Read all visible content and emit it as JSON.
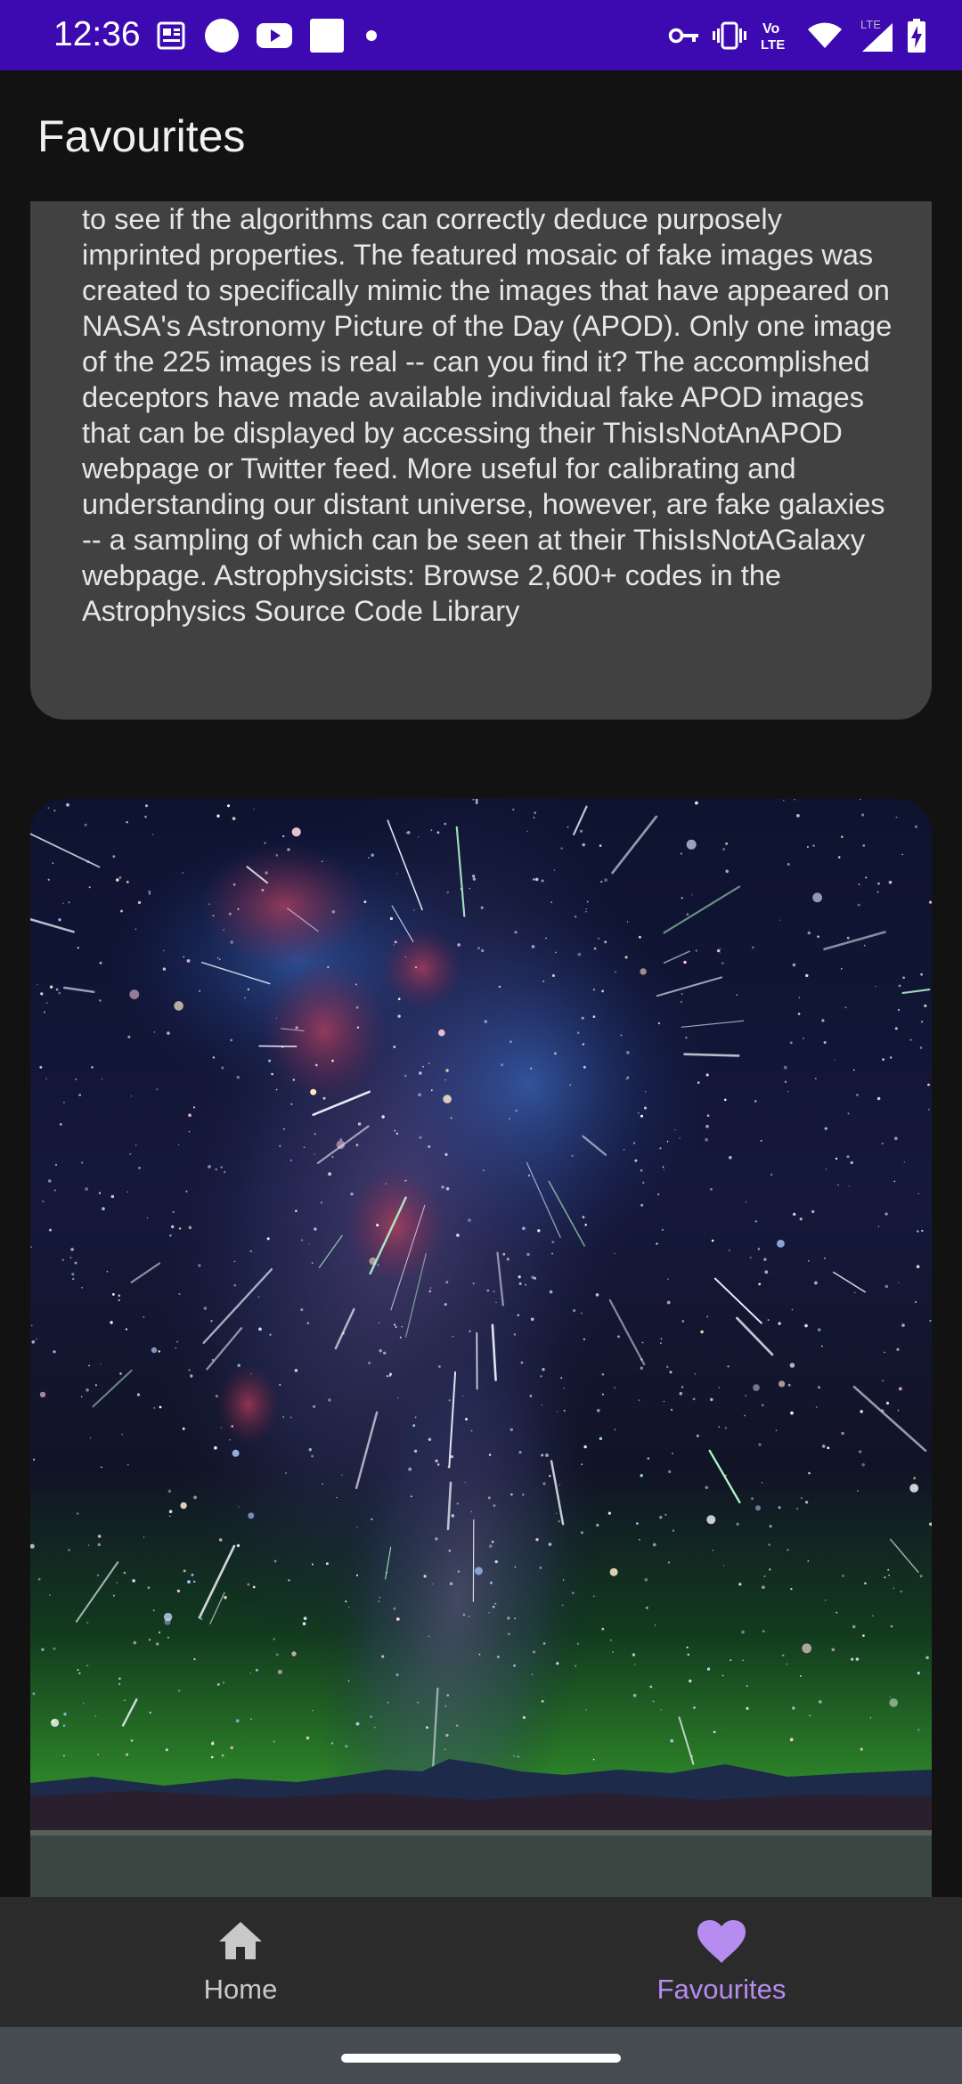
{
  "status_bar": {
    "time": "12:36",
    "left_icons": [
      "news-icon",
      "circle-icon",
      "youtube-icon",
      "square-icon",
      "dot-icon"
    ],
    "right_icons": [
      "vpn-key-icon",
      "vibrate-icon",
      "volte-icon",
      "wifi-icon",
      "lte-signal-icon",
      "battery-charging-icon"
    ],
    "network_label": "LTE",
    "volte_label_top": "Vo",
    "volte_label_bottom": "LTE",
    "background_color": "#3c0ab0"
  },
  "app_bar": {
    "title": "Favourites"
  },
  "entries": [
    {
      "description": "to see if the algorithms can correctly deduce purposely imprinted properties. The featured mosaic of fake images was created to specifically mimic the images that have appeared on NASA's Astronomy Picture of the Day (APOD). Only one image of the 225 images is real -- can you find it? The accomplished deceptors have made available individual fake APOD images that can be displayed by accessing their ThisIsNotAnAPOD webpage or Twitter feed. More useful for calibrating and understanding our distant universe, however, are fake galaxies -- a sampling of which can be seen at their ThisIsNotAGalaxy webpage. Astrophysicists: Browse 2,600+ codes in the Astrophysics Source Code Library"
    },
    {
      "image_subject": "night-sky-meteor-shower-milky-way-photo"
    }
  ],
  "bottom_nav": {
    "items": [
      {
        "label": "Home",
        "icon": "home-icon",
        "selected": false
      },
      {
        "label": "Favourites",
        "icon": "heart-icon",
        "selected": true
      }
    ],
    "accent_color": "#b68cf0"
  }
}
